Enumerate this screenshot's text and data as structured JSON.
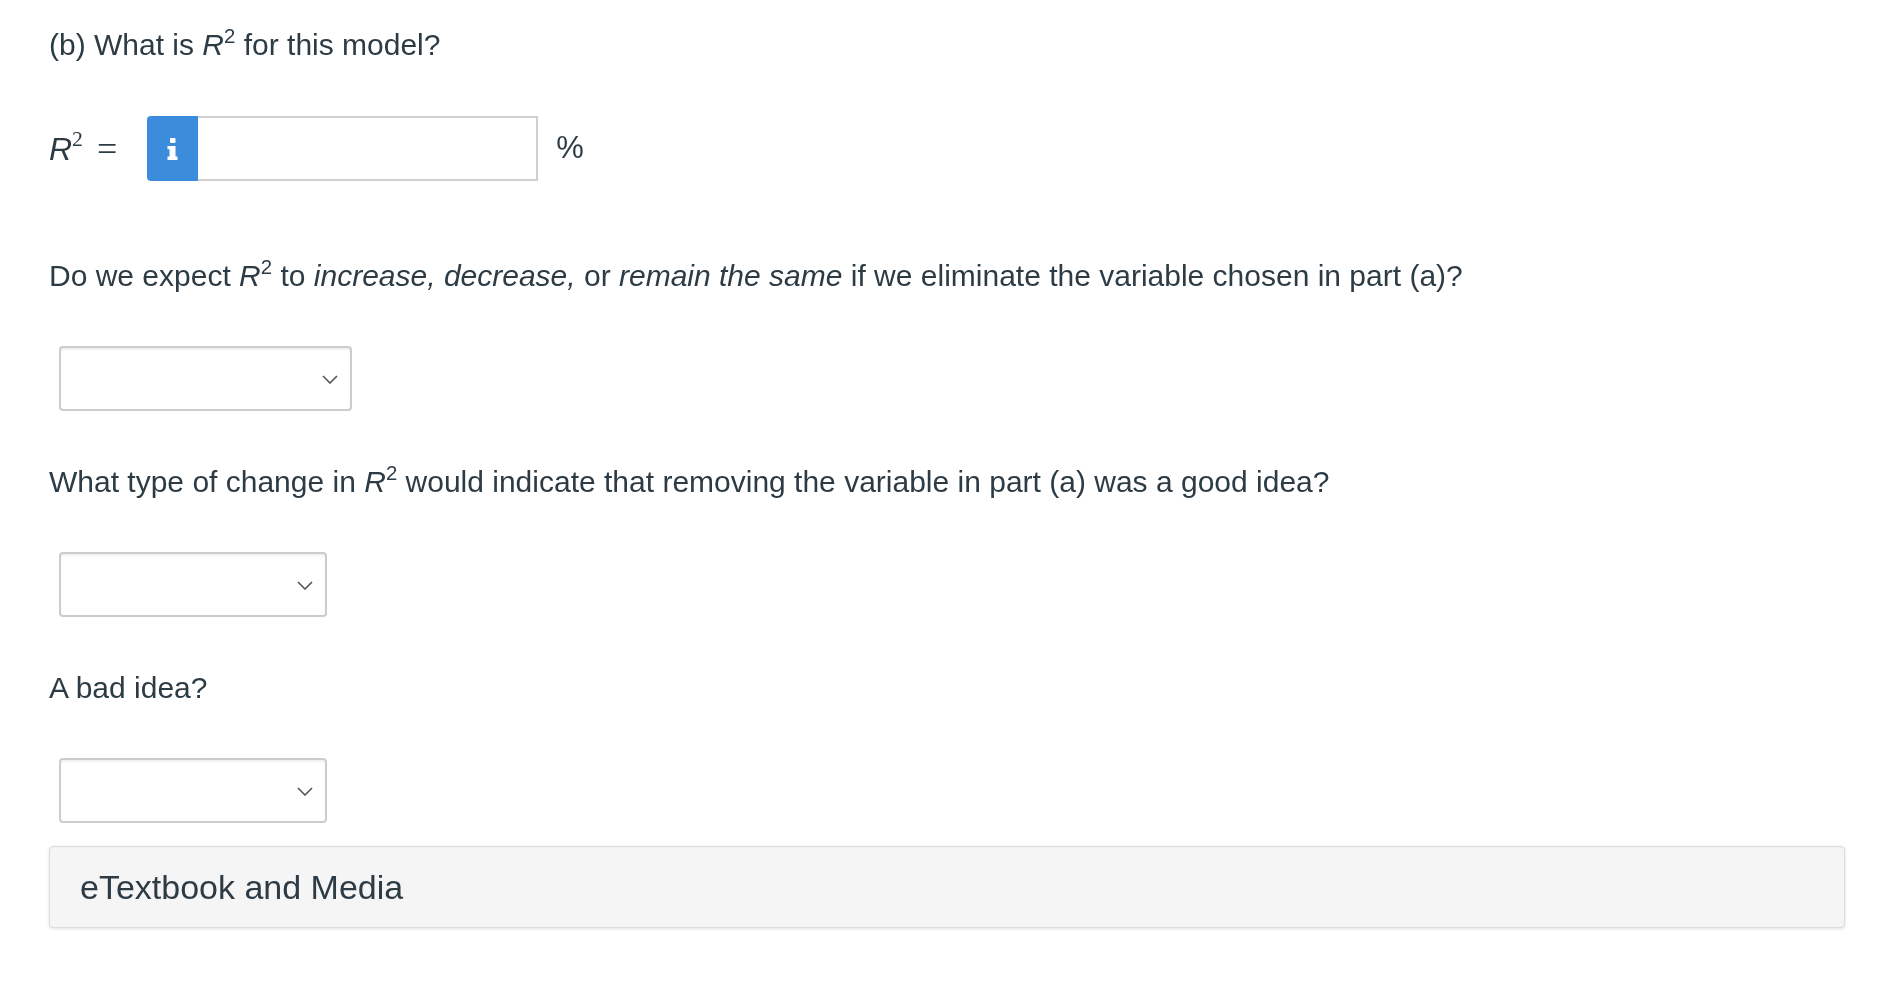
{
  "parts": [
    {
      "kind": "numeric",
      "prompt": "(b) What is *R*$^{2}$ for this model?",
      "label": "*R*$^{2}$",
      "relation": "=",
      "unit": "%"
    },
    {
      "kind": "dropdown",
      "prompt": "Do we expect *R*$^{2}$ to *increase, decrease,* or *remain the same* if we eliminate the variable chosen in part (a)?"
    },
    {
      "kind": "dropdown",
      "prompt": "What type of change in *R*$^{2}$ would indicate that removing the variable in part (a) was a good idea?"
    },
    {
      "kind": "dropdown",
      "prompt": "A bad idea?"
    }
  ],
  "resources": {
    "title": "eTextbook and Media"
  }
}
